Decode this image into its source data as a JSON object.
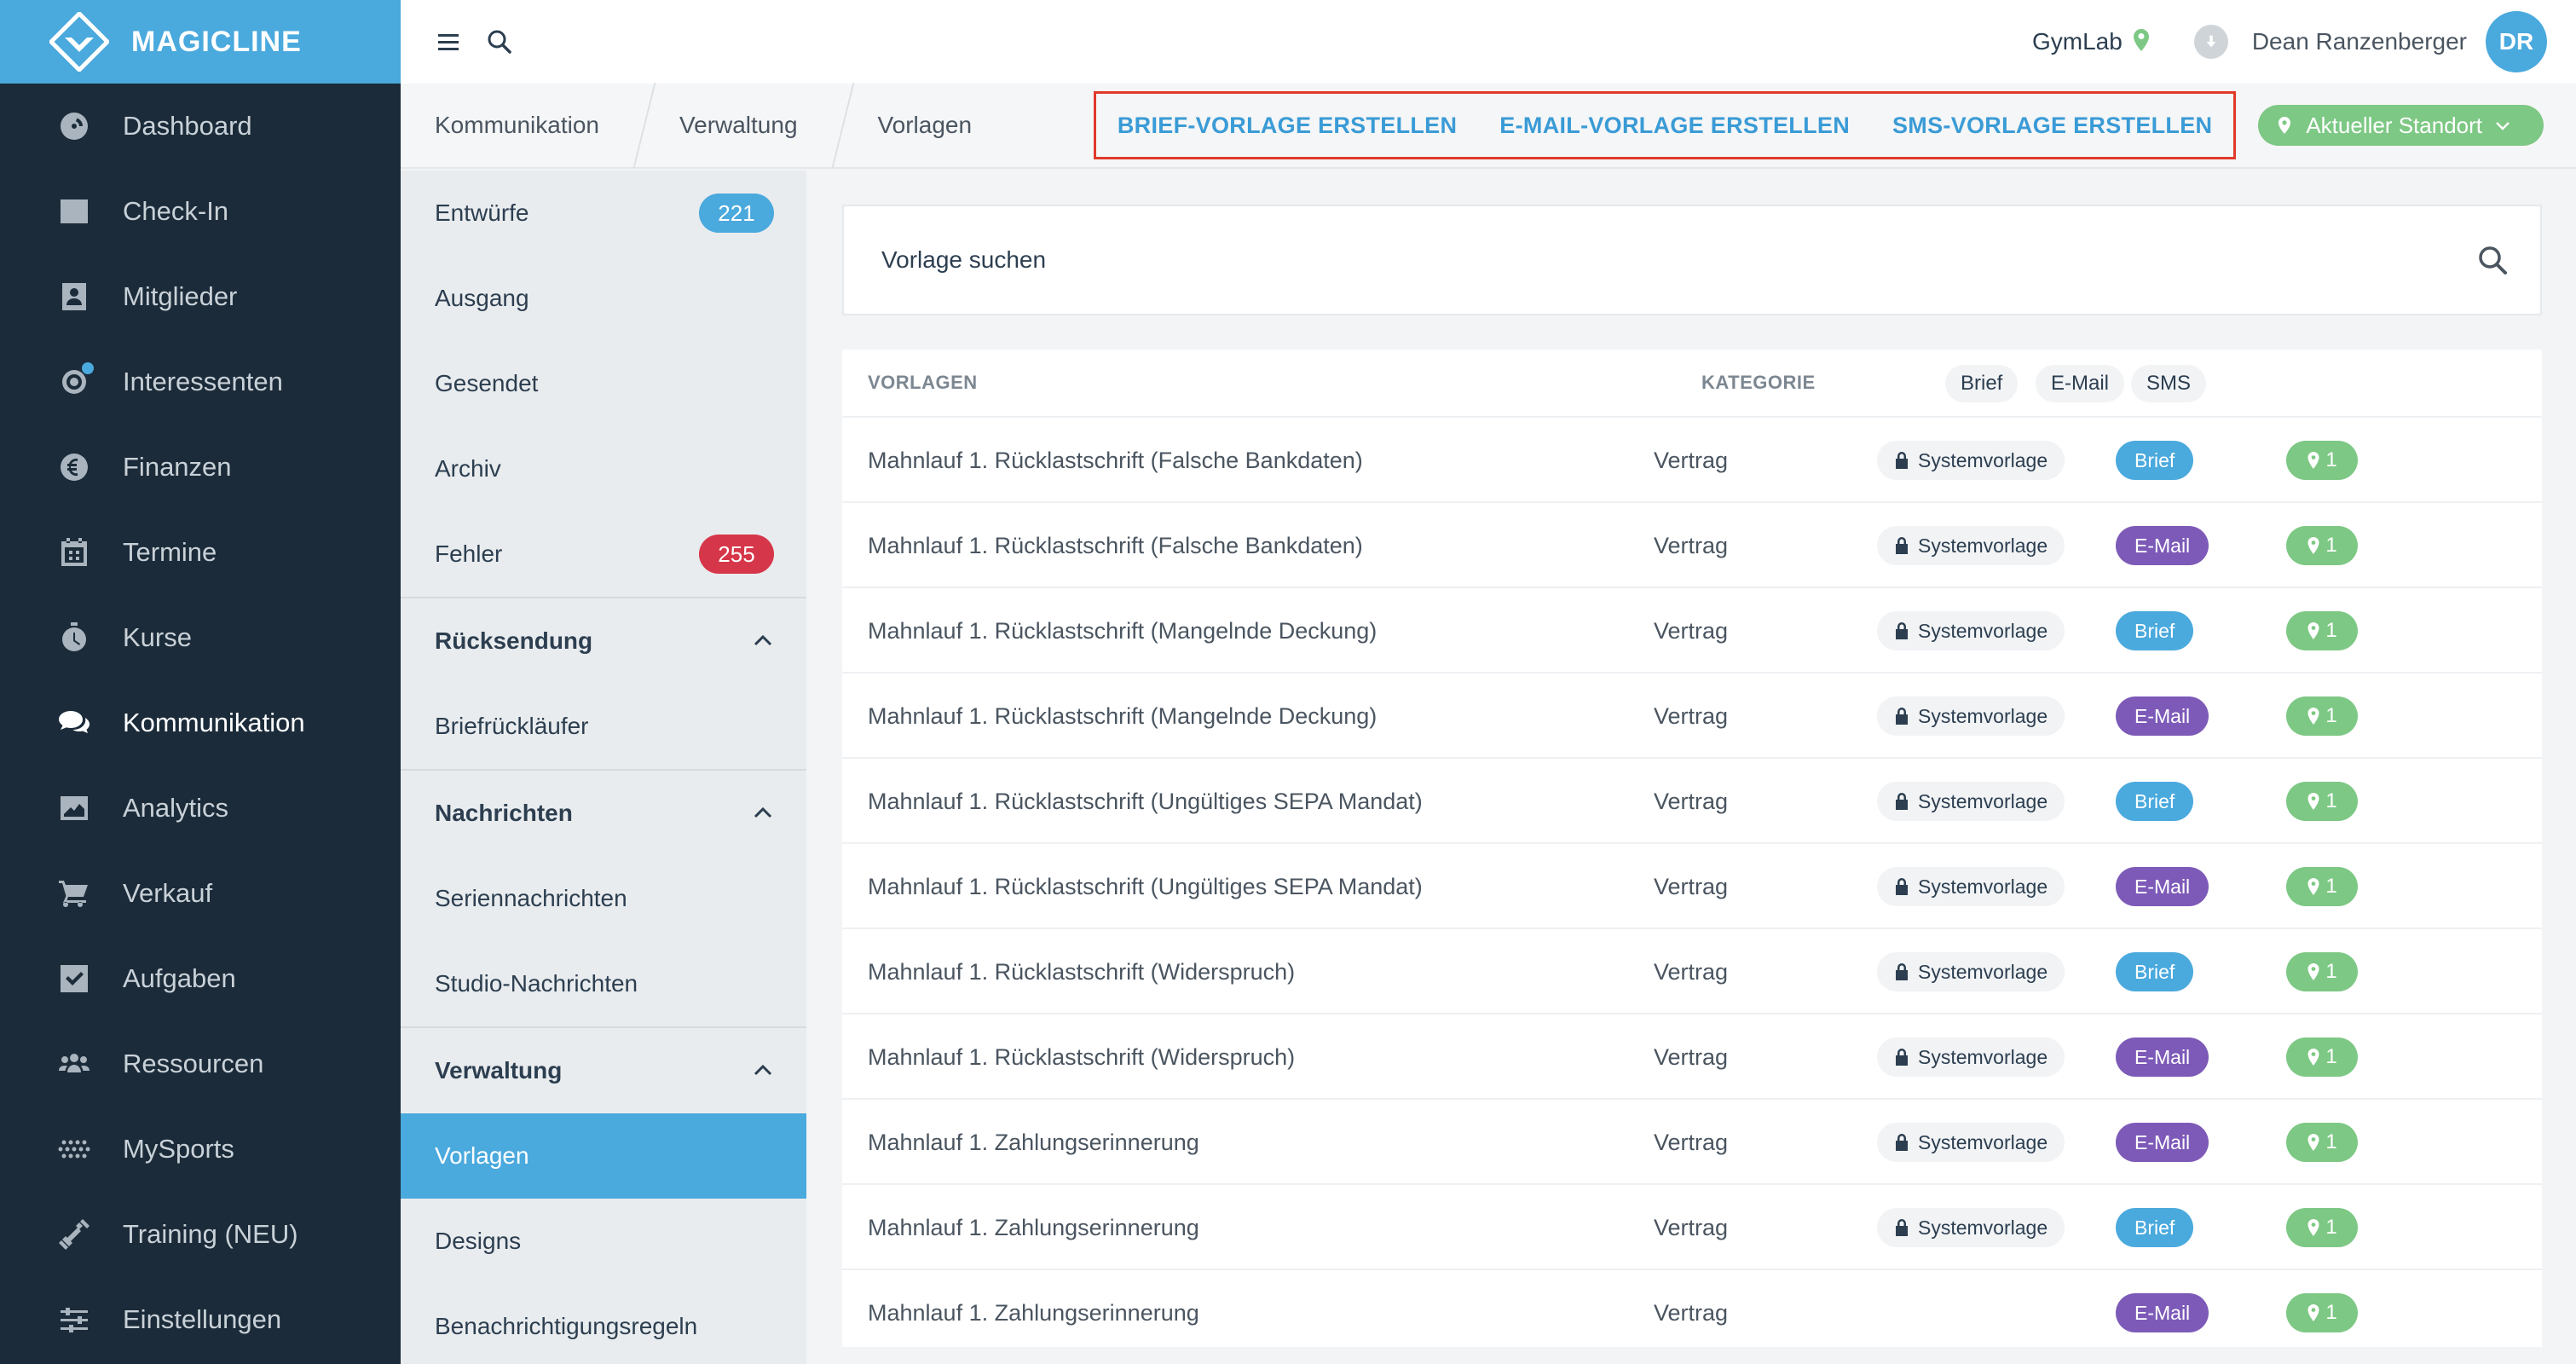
{
  "brand": {
    "name": "MAGICLINE"
  },
  "sidebar": {
    "items": [
      {
        "label": "Dashboard",
        "icon": "dashboard-icon"
      },
      {
        "label": "Check-In",
        "icon": "checkin-icon"
      },
      {
        "label": "Mitglieder",
        "icon": "members-icon"
      },
      {
        "label": "Interessenten",
        "icon": "prospects-icon"
      },
      {
        "label": "Finanzen",
        "icon": "finance-icon"
      },
      {
        "label": "Termine",
        "icon": "calendar-icon"
      },
      {
        "label": "Kurse",
        "icon": "timer-icon"
      },
      {
        "label": "Kommunikation",
        "icon": "chat-icon",
        "active": true
      },
      {
        "label": "Analytics",
        "icon": "analytics-icon"
      },
      {
        "label": "Verkauf",
        "icon": "cart-icon"
      },
      {
        "label": "Aufgaben",
        "icon": "tasks-icon"
      },
      {
        "label": "Ressourcen",
        "icon": "resources-icon"
      },
      {
        "label": "MySports",
        "icon": "mysports-icon"
      },
      {
        "label": "Training (NEU)",
        "icon": "dumbbell-icon"
      },
      {
        "label": "Einstellungen",
        "icon": "settings-icon"
      }
    ]
  },
  "topbar": {
    "studio": "GymLab",
    "user": "Dean Ranzenberger",
    "initials": "DR"
  },
  "breadcrumb": [
    "Kommunikation",
    "Verwaltung",
    "Vorlagen"
  ],
  "actions": {
    "brief": "BRIEF-VORLAGE ERSTELLEN",
    "email": "E-MAIL-VORLAGE ERSTELLEN",
    "sms": "SMS-VORLAGE ERSTELLEN",
    "location": "Aktueller Standort"
  },
  "subnav": {
    "entwuerfe": {
      "label": "Entwürfe",
      "count": "221"
    },
    "ausgang": "Ausgang",
    "gesendet": "Gesendet",
    "archiv": "Archiv",
    "fehler": {
      "label": "Fehler",
      "count": "255"
    },
    "ruecksendung": "Rücksendung",
    "briefrueck": "Briefrückläufer",
    "nachrichten": "Nachrichten",
    "serien": "Seriennachrichten",
    "studio": "Studio-Nachrichten",
    "verwaltung": "Verwaltung",
    "vorlagen": "Vorlagen",
    "designs": "Designs",
    "regeln": "Benachrichtigungsregeln"
  },
  "search": {
    "placeholder": "Vorlage suchen"
  },
  "table": {
    "headers": {
      "name": "VORLAGEN",
      "category": "KATEGORIE"
    },
    "filters": [
      "Brief",
      "E-Mail",
      "SMS"
    ],
    "rows": [
      {
        "name": "Mahnlauf 1. Rücklastschrift (Falsche Bankdaten)",
        "category": "Vertrag",
        "system": "Systemvorlage",
        "type": "Brief",
        "locations": "1"
      },
      {
        "name": "Mahnlauf 1. Rücklastschrift (Falsche Bankdaten)",
        "category": "Vertrag",
        "system": "Systemvorlage",
        "type": "E-Mail",
        "locations": "1"
      },
      {
        "name": "Mahnlauf 1. Rücklastschrift (Mangelnde Deckung)",
        "category": "Vertrag",
        "system": "Systemvorlage",
        "type": "Brief",
        "locations": "1"
      },
      {
        "name": "Mahnlauf 1. Rücklastschrift (Mangelnde Deckung)",
        "category": "Vertrag",
        "system": "Systemvorlage",
        "type": "E-Mail",
        "locations": "1"
      },
      {
        "name": "Mahnlauf 1. Rücklastschrift (Ungültiges SEPA Mandat)",
        "category": "Vertrag",
        "system": "Systemvorlage",
        "type": "Brief",
        "locations": "1"
      },
      {
        "name": "Mahnlauf 1. Rücklastschrift (Ungültiges SEPA Mandat)",
        "category": "Vertrag",
        "system": "Systemvorlage",
        "type": "E-Mail",
        "locations": "1"
      },
      {
        "name": "Mahnlauf 1. Rücklastschrift (Widerspruch)",
        "category": "Vertrag",
        "system": "Systemvorlage",
        "type": "Brief",
        "locations": "1"
      },
      {
        "name": "Mahnlauf 1. Rücklastschrift (Widerspruch)",
        "category": "Vertrag",
        "system": "Systemvorlage",
        "type": "E-Mail",
        "locations": "1"
      },
      {
        "name": "Mahnlauf 1. Zahlungserinnerung",
        "category": "Vertrag",
        "system": "Systemvorlage",
        "type": "E-Mail",
        "locations": "1"
      },
      {
        "name": "Mahnlauf 1. Zahlungserinnerung",
        "category": "Vertrag",
        "system": "Systemvorlage",
        "type": "Brief",
        "locations": "1"
      },
      {
        "name": "Mahnlauf 1. Zahlungserinnerung",
        "category": "Vertrag",
        "system": "",
        "type": "E-Mail",
        "locations": "1"
      }
    ]
  },
  "colors": {
    "brand": "#4aa9dd",
    "sidebar": "#1b2b39",
    "email": "#7d5ab8",
    "location": "#7dc884",
    "error": "#d63649",
    "highlight": "#e03a2b"
  }
}
